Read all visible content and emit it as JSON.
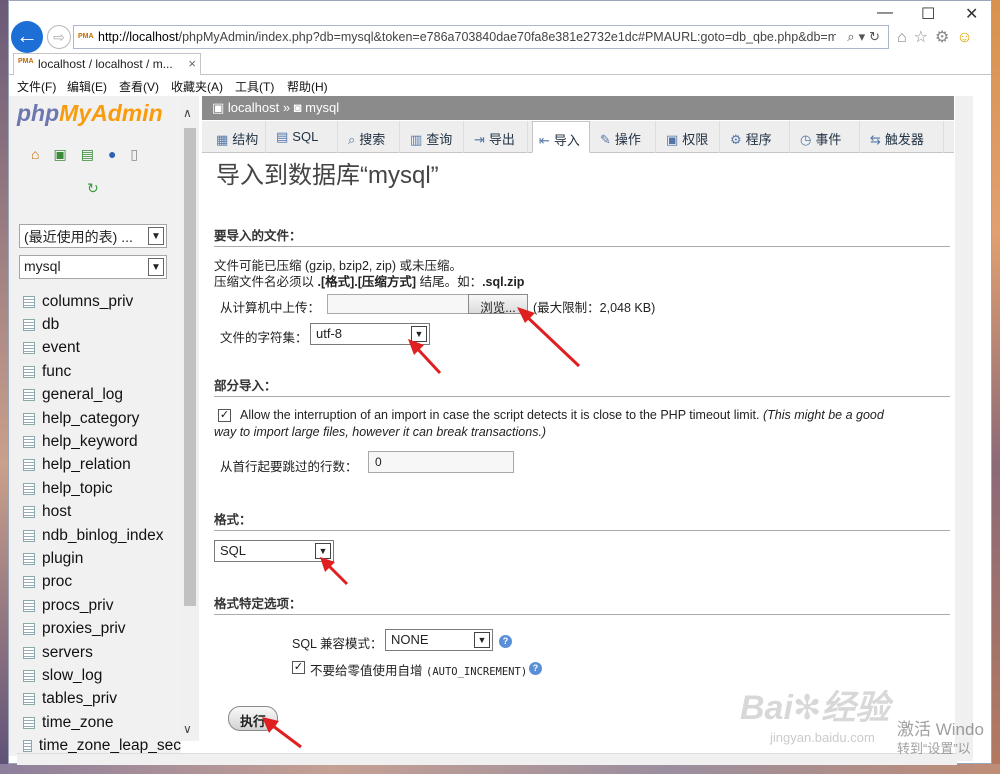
{
  "browser": {
    "url_prefix": "http://localhost",
    "url_rest": "/phpMyAdmin/index.php?db=mysql&token=e786a703840dae70fa8e381e2732e1dc#PMAURL:goto=db_qbe.php&db=my",
    "favicon_text": "PMA",
    "tab_label": "localhost / localhost / m...",
    "tab_close": "×",
    "back_glyph": "←",
    "forward_glyph": "⇨",
    "url_icons": "⌕▾↻",
    "toolbar_icons": "⌂☆⚙",
    "smiley": "☺",
    "window_controls": {
      "minimize": "—",
      "maximize": "☐",
      "close": "✕"
    },
    "menu": [
      "文件(F)",
      "编辑(E)",
      "查看(V)",
      "收藏夹(A)",
      "工具(T)",
      "帮助(H)"
    ]
  },
  "sidebar": {
    "logo_php": "php",
    "logo_my": "My",
    "logo_admin": "Admin",
    "nav_icons": [
      "home-icon",
      "logout-icon",
      "sql-query-icon",
      "help-icon",
      "docs-icon"
    ],
    "nav_glyphs": [
      "⌂",
      "▣",
      "▤",
      "●",
      "▯"
    ],
    "reload_glyph": "↻",
    "recent_select": "(最近使用的表) ...",
    "db_select": "mysql",
    "select_arrow": "▼",
    "tables": [
      "columns_priv",
      "db",
      "event",
      "func",
      "general_log",
      "help_category",
      "help_keyword",
      "help_relation",
      "help_topic",
      "host",
      "ndb_binlog_index",
      "plugin",
      "proc",
      "procs_priv",
      "proxies_priv",
      "servers",
      "slow_log",
      "tables_priv",
      "time_zone",
      "time_zone_leap_sec"
    ],
    "scroll_up": "∧",
    "scroll_down": "∨"
  },
  "breadcrumb": {
    "server": "localhost",
    "sep": "»",
    "db": "mysql"
  },
  "tabs": [
    {
      "label": "结构",
      "icon": "structure-icon",
      "glyph": "▦"
    },
    {
      "label": "SQL",
      "icon": "sql-icon",
      "glyph": "▤"
    },
    {
      "label": "搜索",
      "icon": "search-icon",
      "glyph": "⌕"
    },
    {
      "label": "查询",
      "icon": "query-icon",
      "glyph": "▥"
    },
    {
      "label": "导出",
      "icon": "export-icon",
      "glyph": "⇥"
    },
    {
      "label": "导入",
      "icon": "import-icon",
      "glyph": "⇤"
    },
    {
      "label": "操作",
      "icon": "operations-icon",
      "glyph": "✎"
    },
    {
      "label": "权限",
      "icon": "privileges-icon",
      "glyph": "▣"
    },
    {
      "label": "程序",
      "icon": "routines-icon",
      "glyph": "⚙"
    },
    {
      "label": "事件",
      "icon": "events-icon",
      "glyph": "◷"
    },
    {
      "label": "触发器",
      "icon": "triggers-icon",
      "glyph": "⇆"
    }
  ],
  "active_tab": "导入",
  "main": {
    "title": "导入到数据库“mysql”",
    "file_section": {
      "heading": "要导入的文件：",
      "compress_line1": "文件可能已压缩 (gzip, bzip2, zip) 或未压缩。",
      "compress_line2_a": "压缩文件名必须以 ",
      "compress_line2_b": ".[格式].[压缩方式]",
      "compress_line2_c": " 结尾。如：",
      "compress_line2_d": ".sql.zip",
      "upload_label": "从计算机中上传：",
      "browse_button": "浏览...",
      "max_limit": "(最大限制：2,048 KB)",
      "charset_label": "文件的字符集：",
      "charset_value": "utf-8"
    },
    "partial_section": {
      "heading": "部分导入：",
      "allow_interrupt_checked": true,
      "allow_interrupt_text": "Allow the interruption of an import in case the script detects it is close to the PHP timeout limit.",
      "allow_interrupt_note_a": "(This might be a good",
      "allow_interrupt_note_b": "way to import large files, however it can break transactions.)",
      "skip_label": "从首行起要跳过的行数：",
      "skip_value": "0"
    },
    "format_section": {
      "heading": "格式：",
      "format_value": "SQL"
    },
    "format_options_section": {
      "heading": "格式特定选项：",
      "compat_label": "SQL 兼容模式：",
      "compat_value": "NONE",
      "no_auto_value_checked": true,
      "no_auto_value_label": "不要给零值使用自增",
      "no_auto_value_code": "(AUTO_INCREMENT)"
    },
    "execute_button": "执行",
    "checkmark": "✓",
    "help_glyph": "?"
  },
  "watermark": {
    "brand": "Bai",
    "brand_cn": "经验",
    "site": "jingyan.baidu.com"
  },
  "windows_activation": {
    "line1": "激活 Windo",
    "line2": "转到“设置”以"
  },
  "colors": {
    "accent_blue": "#1d6fd6",
    "pma_orange": "#f89c0e",
    "pma_blue": "#6c78af",
    "breadcrumb_bg": "#8b8b8b",
    "arrow_red": "#e02020"
  }
}
